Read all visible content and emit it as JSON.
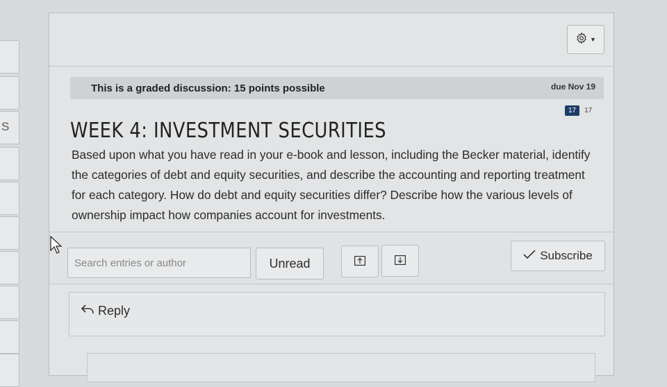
{
  "leftnav": {
    "visible_fragment": "S"
  },
  "discussion": {
    "graded_notice": "This is a graded discussion: 15 points possible",
    "due": "due Nov 19",
    "title": "WEEK 4: INVESTMENT SECURITIES",
    "unread_count": "17",
    "total_count": "17",
    "prompt": "Based upon what you have read in your e-book and lesson, including the Becker material, identify the categories of debt and equity securities, and describe the accounting and reporting treatment for each category. How do debt and equity securities differ? Describe how the various levels of ownership impact how companies account for investments."
  },
  "toolbar": {
    "search_placeholder": "Search entries or author",
    "unread_label": "Unread",
    "subscribe_label": "Subscribe"
  },
  "reply": {
    "label": "Reply"
  },
  "icons": {
    "settings": "gear-icon",
    "expand": "arrow-up-box-icon",
    "collapse": "arrow-down-box-icon",
    "subscribe": "checkmark-icon",
    "reply": "reply-arrow-icon"
  }
}
